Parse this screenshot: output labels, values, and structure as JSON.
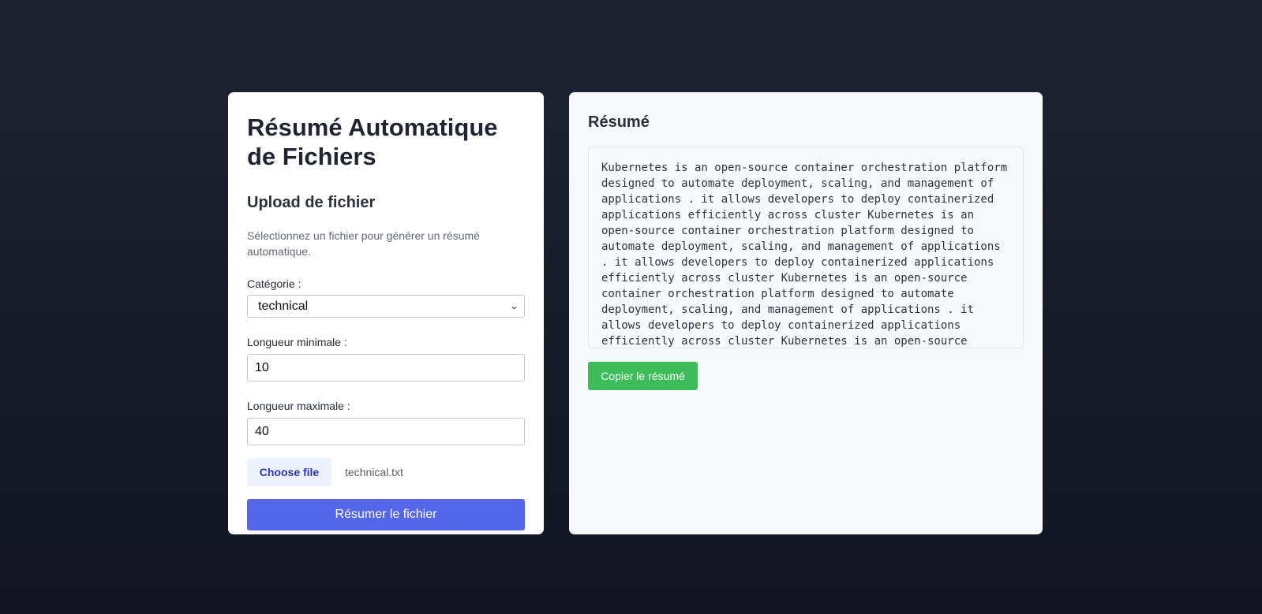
{
  "form": {
    "title": "Résumé Automatique de Fichiers",
    "section_title": "Upload de fichier",
    "description": "Sélectionnez un fichier pour générer un résumé automatique.",
    "category_label": "Catégorie :",
    "category_value": "technical",
    "min_length_label": "Longueur minimale :",
    "min_length_value": "10",
    "max_length_label": "Longueur maximale :",
    "max_length_value": "40",
    "choose_file_label": "Choose file",
    "file_name": "technical.txt",
    "submit_label": "Résumer le fichier"
  },
  "summary": {
    "title": "Résumé",
    "text": "Kubernetes is an open-source container orchestration platform\ndesigned to automate deployment, scaling, and management of\napplications . it allows developers to deploy containerized\napplications efficiently across cluster Kubernetes is an\nopen-source container orchestration platform designed to\nautomate deployment, scaling, and management of applications\n. it allows developers to deploy containerized applications\nefficiently across cluster Kubernetes is an open-source\ncontainer orchestration platform designed to automate\ndeployment, scaling, and management of applications . it\nallows developers to deploy containerized applications\nefficiently across cluster Kubernetes is an open-source",
    "copy_label": "Copier le résumé"
  },
  "colors": {
    "primary": "#5466ea",
    "success": "#3dbd59",
    "file_button_bg": "#eef1fe",
    "file_button_text": "#2b34b8"
  }
}
